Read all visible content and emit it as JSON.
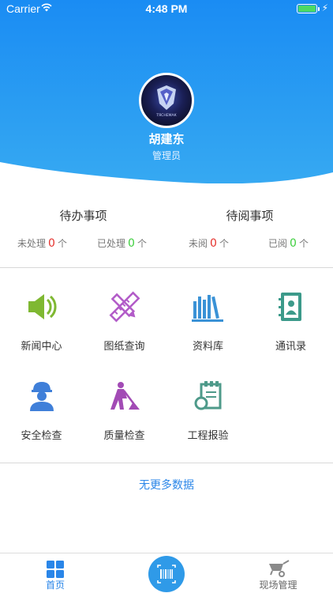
{
  "status_bar": {
    "carrier": "Carrier",
    "time": "4:48 PM",
    "charge": "⚡"
  },
  "profile": {
    "name": "胡建东",
    "role": "管理员",
    "avatar_text": "ТЯСНЕМАК"
  },
  "todo": {
    "title": "待办事项",
    "unprocessed": {
      "label": "未处理",
      "count": "0",
      "unit": "个"
    },
    "processed": {
      "label": "已处理",
      "count": "0",
      "unit": "个"
    }
  },
  "toread": {
    "title": "待阅事项",
    "unread": {
      "label": "未阅",
      "count": "0",
      "unit": "个"
    },
    "read": {
      "label": "已阅",
      "count": "0",
      "unit": "个"
    }
  },
  "grid": {
    "news": "新闻中心",
    "drawings": "图纸查询",
    "library": "资料库",
    "contacts": "通讯录",
    "safety": "安全检查",
    "quality": "质量检查",
    "report": "工程报验"
  },
  "icons": {
    "news": "speaker-icon",
    "drawings": "ruler-pencil-icon",
    "library": "books-icon",
    "contacts": "address-book-icon",
    "safety": "worker-helmet-icon",
    "quality": "digging-worker-icon",
    "report": "clipboard-icon",
    "home": "grid-icon",
    "scan": "barcode-icon",
    "site": "wheelbarrow-icon"
  },
  "colors": {
    "header_blue": "#1e8cf0",
    "news": "#7fb832",
    "drawings": "#b25bc8",
    "library": "#3a92d6",
    "contacts": "#3c9a8a",
    "safety": "#3f7fd9",
    "quality": "#a24bb5",
    "report": "#4e9a8a",
    "accent": "#2a86e8"
  },
  "footer": {
    "no_more": "无更多数据"
  },
  "tabbar": {
    "home": "首页",
    "site": "现场管理"
  }
}
